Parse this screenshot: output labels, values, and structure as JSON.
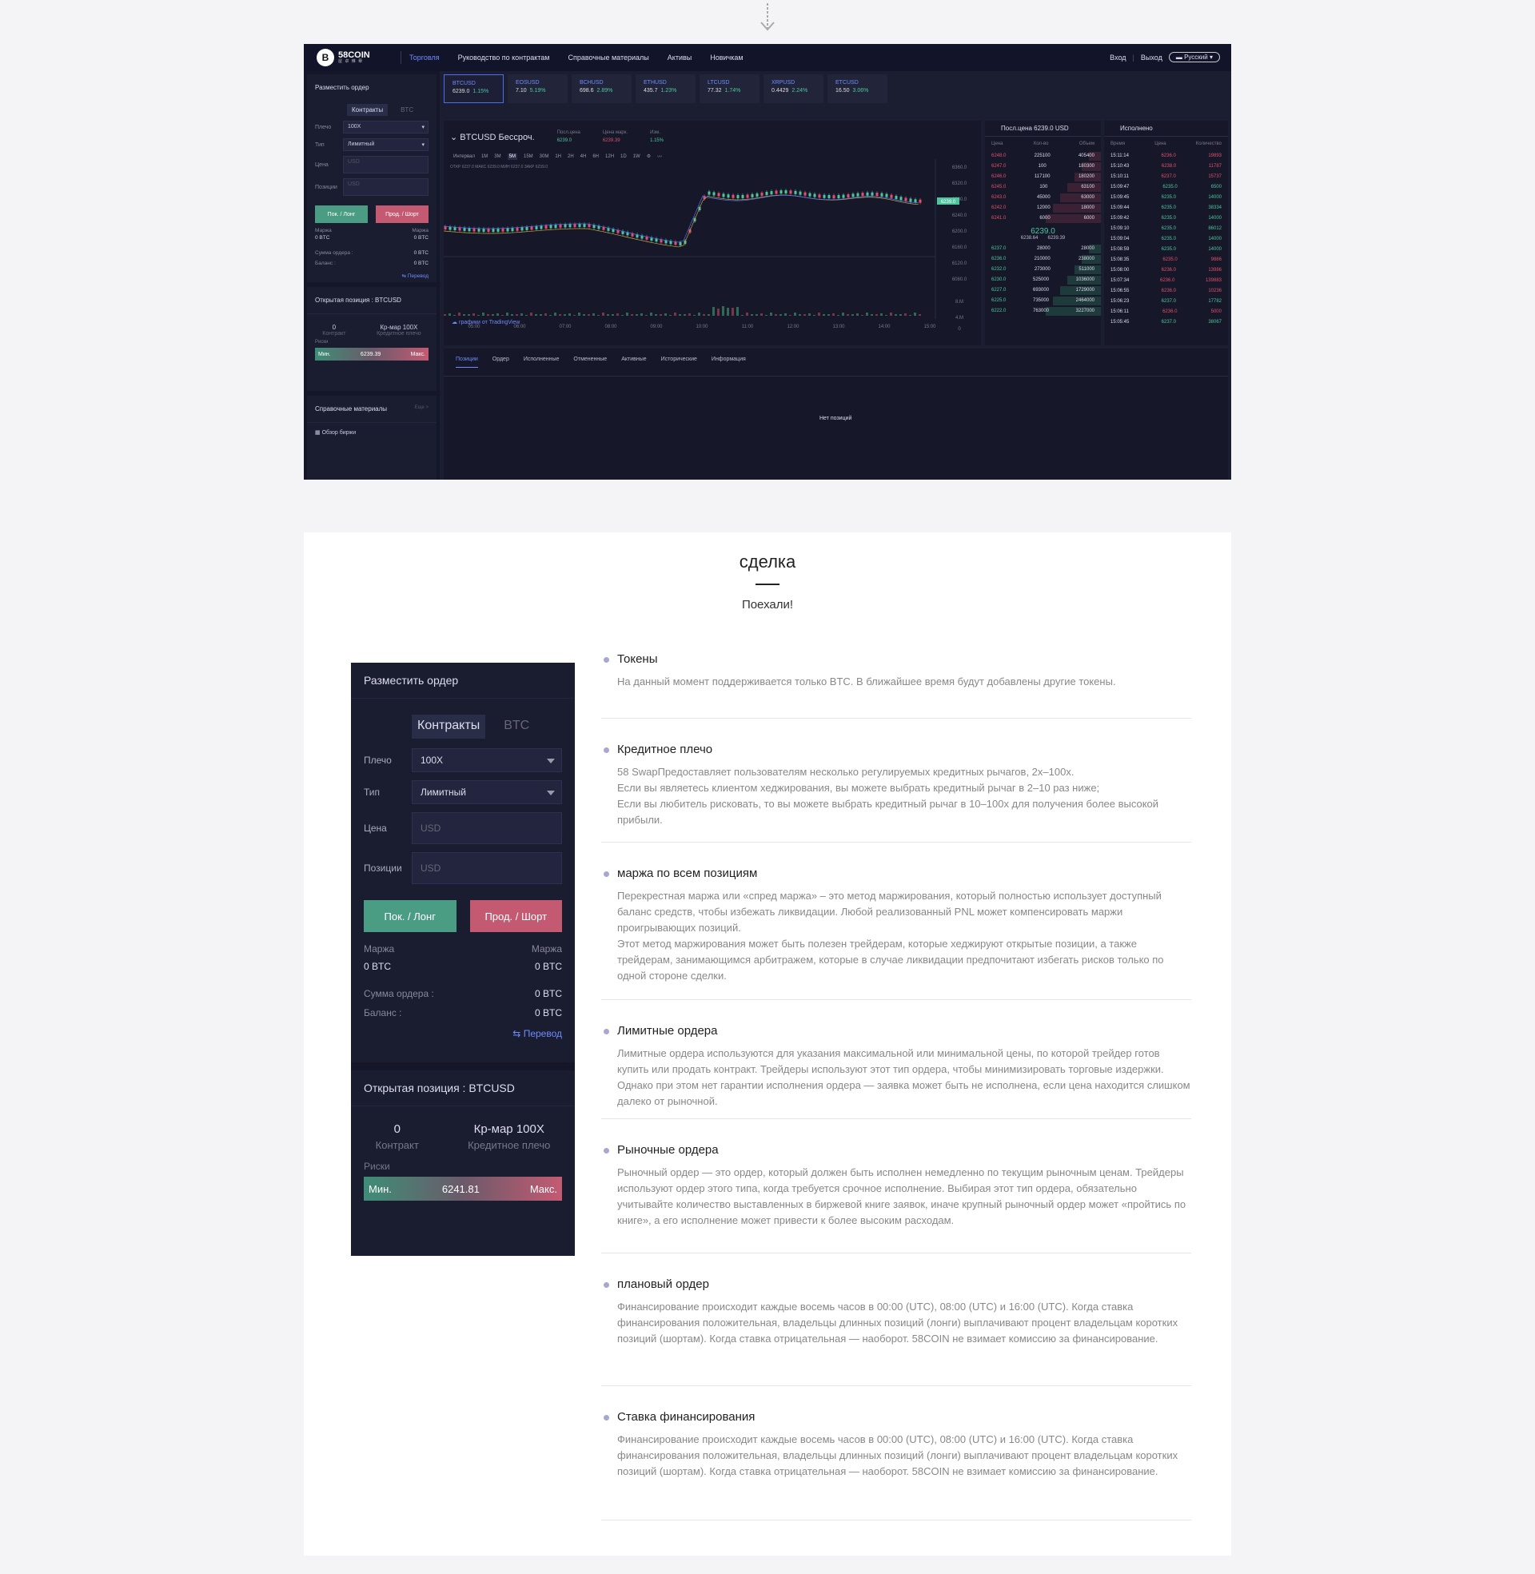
{
  "terminal": {
    "logo": {
      "brand": "58COIN",
      "sub": "屋 卓 帷 舉"
    },
    "nav": [
      "Торговля",
      "Руководство по контрактам",
      "Справочные материалы",
      "Активы",
      "Новичкам"
    ],
    "login": "Вход",
    "logout": "Выход",
    "lang": "Русский",
    "order": {
      "title": "Разместить ордер",
      "tab_contracts": "Контракты",
      "tab_btc": "BTC",
      "leverage_label": "Плечо",
      "leverage": "100X",
      "type_label": "Тип",
      "type": "Лимитный",
      "price_label": "Цена",
      "price_ph": "USD",
      "pos_label": "Позиции",
      "pos_ph": "USD",
      "buy": "Пок. / Лонг",
      "sell": "Прод. / Шорт",
      "margin": "Маржа",
      "margin_val": "0 BTC",
      "order_sum": "Сумма ордера :",
      "order_sum_val": "0 BTC",
      "balance": "Баланс :",
      "balance_val": "0 BTC",
      "transfer": "Перевод"
    },
    "open_pos": {
      "title": "Открытая позиция : BTCUSD",
      "qty": "0",
      "qty_label": "Контракт",
      "lev": "Кр-мар 100X",
      "lev_label": "Кредитное плечо",
      "risk": "Риски",
      "min": "Мин.",
      "max": "Макс.",
      "value": "6239.39"
    },
    "refs": {
      "title": "Справочные материалы",
      "more": "Еще >",
      "item": "Обзор биржи"
    },
    "tickers": [
      {
        "name": "BTCUSD",
        "price": "6239.0",
        "change": "1.15%"
      },
      {
        "name": "EOSUSD",
        "price": "7.10",
        "change": "5.19%"
      },
      {
        "name": "BCHUSD",
        "price": "698.6",
        "change": "2.89%"
      },
      {
        "name": "ETHUSD",
        "price": "435.7",
        "change": "1.23%"
      },
      {
        "name": "LTCUSD",
        "price": "77.32",
        "change": "1.74%"
      },
      {
        "name": "XRPUSD",
        "price": "0.4429",
        "change": "2.24%"
      },
      {
        "name": "ETCUSD",
        "price": "16.50",
        "change": "3.06%"
      }
    ],
    "chart": {
      "symbol": "BTCUSD Бессроч.",
      "last_label": "Посл.цена",
      "last": "6239.0",
      "mark_label": "Цена марк.",
      "mark": "6239.39",
      "chg_label": "Изм.",
      "chg": "1.15%",
      "interval_label": "Интервал",
      "intervals": [
        "1М",
        "3М",
        "5М",
        "15М",
        "30М",
        "1Н",
        "2Н",
        "4Н",
        "6Н",
        "12Н",
        "1D",
        "1W"
      ],
      "ohlc": "ОТКР 6237.0 МАКС 6239.0 МИН 6237.0 ЗАКР 6239.0",
      "tv": "графики от TradingView",
      "yticks": [
        "6360.0",
        "6320.0",
        "6280.0",
        "6240.0",
        "6200.0",
        "6160.0",
        "6120.0",
        "6080.0",
        "8.M",
        "4.M",
        "0"
      ],
      "xticks": [
        "05:00",
        "06:00",
        "07:00",
        "08:00",
        "09:00",
        "10:00",
        "11:00",
        "12:00",
        "13:00",
        "14:00",
        "15:00"
      ],
      "price_tag": "6239.0"
    },
    "orderbook": {
      "title": "Посл.цена 6239.0 USD",
      "cols": [
        "Цена",
        "Кол-во",
        "Объем"
      ],
      "asks": [
        [
          "6248.0",
          "225100",
          "405400"
        ],
        [
          "6247.0",
          "100",
          "180300"
        ],
        [
          "6246.0",
          "117100",
          "180200"
        ],
        [
          "6245.0",
          "100",
          "63100"
        ],
        [
          "6243.0",
          "45000",
          "63000"
        ],
        [
          "6242.0",
          "12000",
          "18000"
        ],
        [
          "6241.0",
          "6000",
          "6000"
        ]
      ],
      "mid": "6239.0",
      "mid_sub1": "6238.64",
      "mid_sub2": "6239.39",
      "bids": [
        [
          "6237.0",
          "28000",
          "28000"
        ],
        [
          "6236.0",
          "210000",
          "238000"
        ],
        [
          "6232.0",
          "273000",
          "511000"
        ],
        [
          "6230.0",
          "525000",
          "1036000"
        ],
        [
          "6227.0",
          "693000",
          "1729000"
        ],
        [
          "6225.0",
          "735000",
          "2464000"
        ],
        [
          "6222.0",
          "763000",
          "3227000"
        ]
      ]
    },
    "trades": {
      "title": "Исполнено",
      "cols": [
        "Время",
        "Цена",
        "Количество"
      ],
      "rows": [
        [
          "15:11:14",
          "6236.0",
          "19893",
          "r"
        ],
        [
          "15:10:43",
          "6238.0",
          "11787",
          "r"
        ],
        [
          "15:10:11",
          "6237.0",
          "15737",
          "r"
        ],
        [
          "15:09:47",
          "6235.0",
          "6500",
          "g"
        ],
        [
          "15:09:45",
          "6235.0",
          "14000",
          "g"
        ],
        [
          "15:09:44",
          "6235.0",
          "38334",
          "g"
        ],
        [
          "15:09:42",
          "6235.0",
          "14000",
          "g"
        ],
        [
          "15:09:10",
          "6235.0",
          "86012",
          "g"
        ],
        [
          "15:09:04",
          "6235.0",
          "14000",
          "g"
        ],
        [
          "15:08:59",
          "6235.0",
          "14000",
          "g"
        ],
        [
          "15:08:35",
          "6235.0",
          "9886",
          "r"
        ],
        [
          "15:08:00",
          "6236.0",
          "13986",
          "r"
        ],
        [
          "15:07:34",
          "6236.0",
          "139883",
          "r"
        ],
        [
          "15:06:55",
          "6236.0",
          "10236",
          "r"
        ],
        [
          "15:06:23",
          "6237.0",
          "17782",
          "g"
        ],
        [
          "15:06:11",
          "6236.0",
          "5000",
          "r"
        ],
        [
          "15:05:45",
          "6237.0",
          "38067",
          "g"
        ]
      ]
    },
    "bottom": {
      "tabs": [
        "Позиции",
        "Ордер",
        "Исполненные",
        "Отмененные",
        "Активные",
        "Исторические",
        "Информация"
      ],
      "empty": "Нет позиций"
    }
  },
  "section": {
    "title": "сделка",
    "subtitle": "Поехали!"
  },
  "panel": {
    "title": "Разместить ордер",
    "tab_contracts": "Контракты",
    "tab_btc": "BTC",
    "leverage_label": "Плечо",
    "leverage": "100X",
    "type_label": "Тип",
    "type": "Лимитный",
    "price_label": "Цена",
    "price_ph": "USD",
    "pos_label": "Позиции",
    "pos_ph": "USD",
    "buy": "Пок. / Лонг",
    "sell": "Прод. / Шорт",
    "margin": "Маржа",
    "margin_val": "0 BTC",
    "order_sum": "Сумма ордера :",
    "order_sum_val": "0 BTC",
    "balance": "Баланс :",
    "balance_val": "0 BTC",
    "transfer": "Перевод",
    "pos_title": "Открытая позиция : BTCUSD",
    "qty": "0",
    "qty_label": "Контракт",
    "lev": "Кр-мар 100X",
    "lev_label": "Кредитное плечо",
    "risk": "Риски",
    "min": "Мин.",
    "max": "Макс.",
    "value": "6241.81"
  },
  "items": [
    {
      "title": "Токены",
      "body": "На данный момент поддерживается только BTC. В ближайшее время будут добавлены другие токены."
    },
    {
      "title": "Кредитное плечо",
      "body": "58 SwapПредоставляет пользователям несколько регулируемых кредитных рычагов, 2x–100x.\nЕсли вы являетесь клиентом хеджирования, вы можете выбрать кредитный рычаг в 2–10 раз ниже;\nЕсли вы любитель рисковать, то вы можете выбрать кредитный рычаг в 10–100х для получения более высокой прибыли."
    },
    {
      "title": "маржа по всем позициям",
      "body": "Перекрестная маржа или «спред маржа» – это метод маржирования, который полностью использует доступный баланс средств, чтобы избежать ликвидации. Любой реализованный PNL может компенсировать маржи проигрывающих позиций.\nЭтот метод маржирования может быть полезен трейдерам, которые хеджируют открытые позиции, а также трейдерам, занимающимся арбитражем, которые в случае ликвидации предпочитают избегать рисков только по одной стороне сделки."
    },
    {
      "title": "Лимитные ордера",
      "body": "Лимитные ордера используются для указания максимальной или минимальной цены, по которой трейдер готов купить или продать контракт. Трейдеры используют этот тип ордера, чтобы минимизировать торговые издержки. Однако при этом нет гарантии исполнения ордера — заявка может быть не исполнена, если цена находится слишком далеко от рыночной."
    },
    {
      "title": "Рыночные ордера",
      "body": "Рыночный ордер — это ордер, который должен быть исполнен немедленно по текущим рыночным ценам. Трейдеры используют ордер этого типа, когда требуется срочное исполнение. Выбирая этот тип ордера, обязательно учитывайте количество выставленных в биржевой книге заявок, иначе крупный рыночный ордер может «пройтись по книге», а его исполнение может привести к более высоким расходам."
    },
    {
      "title": "плановый ордер",
      "body": "Финансирование происходит каждые восемь часов в 00:00 (UTC), 08:00 (UTC) и 16:00 (UTC). Когда ставка финансирования положительная, владельцы длинных позиций (лонги) выплачивают процент владельцам коротких позиций (шортам). Когда ставка отрицательная — наоборот. 58COIN не взимает комиссию за финансирование."
    },
    {
      "title": "Ставка финансирования",
      "body": "Финансирование происходит каждые восемь часов в 00:00 (UTC), 08:00 (UTC) и 16:00 (UTC). Когда ставка финансирования положительная, владельцы длинных позиций (лонги) выплачивают процент владельцам коротких позиций (шортам). Когда ставка отрицательная — наоборот. 58COIN не взимает комиссию за финансирование."
    }
  ]
}
